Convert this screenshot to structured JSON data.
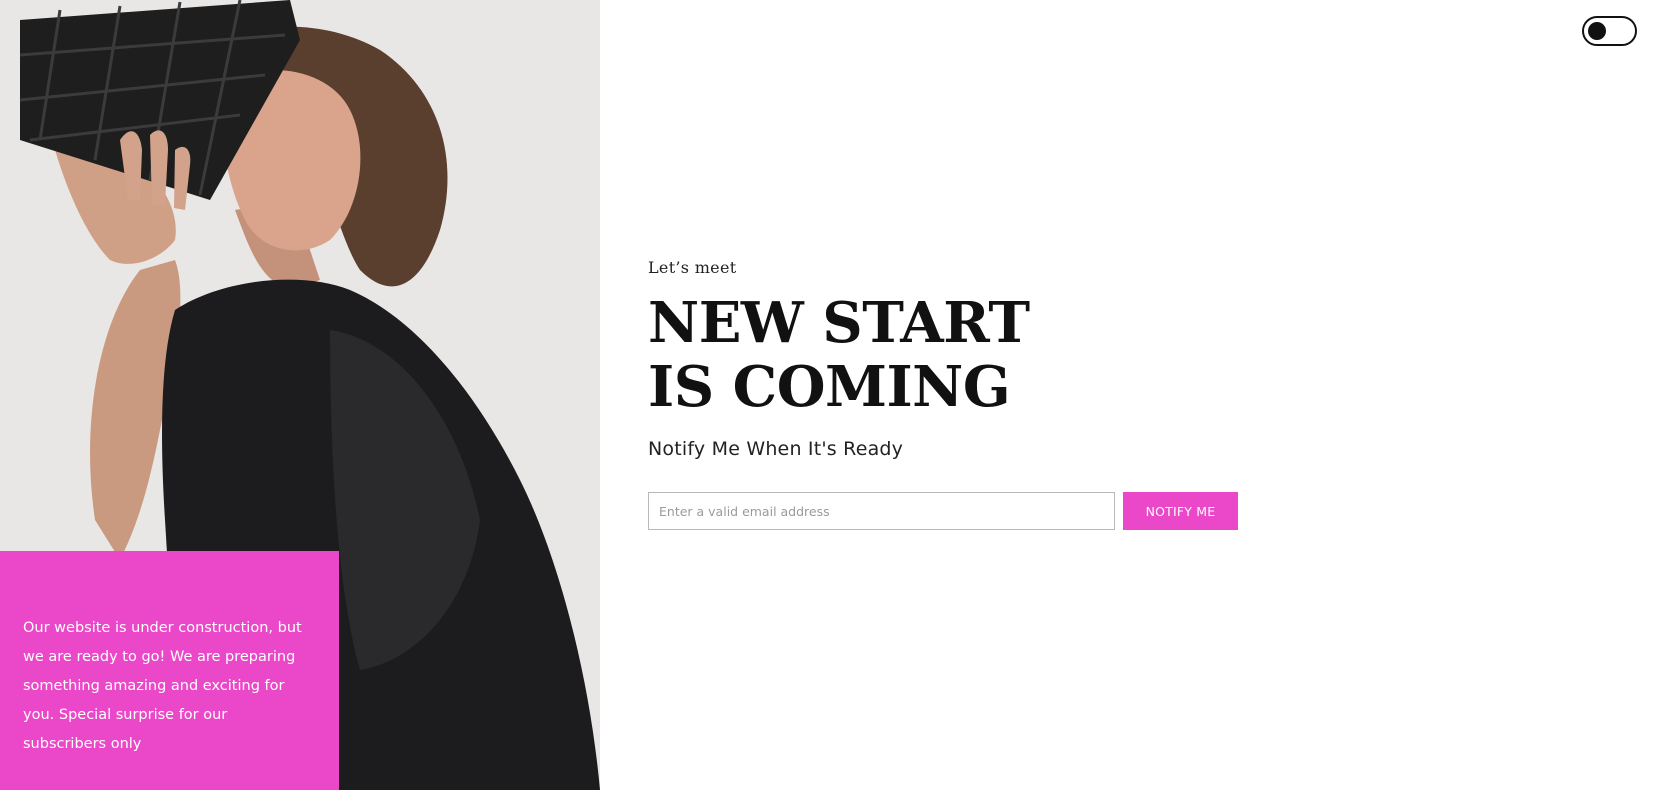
{
  "colors": {
    "accent": "#ea48c9",
    "text": "#111111",
    "background": "#ffffff"
  },
  "hero": {
    "image": "woman-in-black-dress-holding-quilted-handbag"
  },
  "info_box": {
    "text": "Our website is under construction, but we are ready to go! We are preparing something amazing and exciting for you. Special surprise for our subscribers only"
  },
  "toggle": {
    "icon": "theme-toggle-icon",
    "state": "off"
  },
  "main": {
    "eyebrow": "Let’s meet",
    "headline_line1": "NEW START",
    "headline_line2": "IS COMING",
    "subhead": "Notify Me When It's Ready"
  },
  "form": {
    "email_placeholder": "Enter a valid email address",
    "email_value": "",
    "button_label": "NOTIFY ME"
  }
}
